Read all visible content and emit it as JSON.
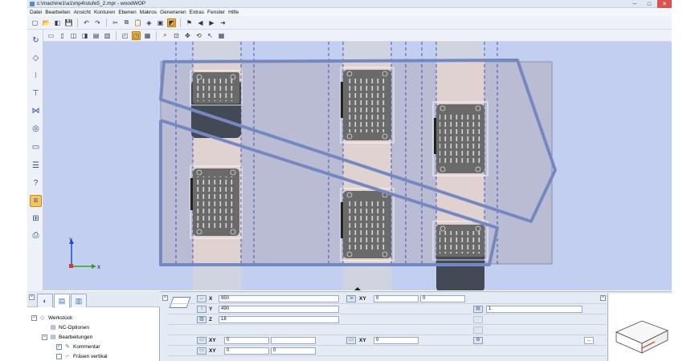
{
  "window": {
    "title": "c:\\machine1\\a1\\mp4\\stufe5_2.mpr - woodWOP",
    "controls": {
      "minimize": "─",
      "maximize": "□",
      "close": "✕"
    }
  },
  "menu": [
    "Datei",
    "Bearbeiten",
    "Ansicht",
    "Konturen",
    "Ebenen",
    "Makros",
    "Generieren",
    "Extras",
    "Fenster",
    "Hilfe"
  ],
  "toolbar1": {
    "icons": [
      "new-file-icon",
      "open-icon",
      "open-recent-icon",
      "save-icon",
      "undo-icon",
      "redo-icon",
      "cut-icon",
      "copy-icon",
      "paste-icon",
      "view-3d-icon",
      "view-top-icon",
      "view-iso-icon",
      "filter-icon",
      "back-icon",
      "play-icon",
      "forward-icon"
    ],
    "glyphs": [
      "▢",
      "📂",
      "◧",
      "💾",
      "↶",
      "↷",
      "✂",
      "⧉",
      "📋",
      "◈",
      "▣",
      "◩",
      "⚑",
      "◀",
      "▶",
      "➜"
    ]
  },
  "toolbar2": {
    "icons": [
      "view-front-icon",
      "view-back-icon",
      "view-left-icon",
      "view-right-icon",
      "view-top-icon",
      "view-bottom-icon",
      "wireframe-icon",
      "shaded-icon",
      "render-icon",
      "zoom-icon",
      "zoom-fit-icon",
      "pan-icon",
      "rotate-icon",
      "pointer-icon",
      "grid-icon"
    ],
    "glyphs": [
      "▭",
      "▯",
      "◫",
      "◨",
      "▤",
      "▥",
      "◰",
      "◳",
      "▦",
      "⌕",
      "⊡",
      "✥",
      "⟲",
      "↖",
      "▦"
    ]
  },
  "left_tools": {
    "items": [
      "contour-tool",
      "workpiece-tool",
      "drill-tool",
      "router-tool",
      "saw-tool",
      "circle-tool",
      "pocket-tool",
      "document-tool",
      "help-macro-tool",
      "component-tool",
      "group-tool",
      "print-tool"
    ],
    "glyphs": [
      "↻",
      "◇",
      "⁝",
      "⊤",
      "⋈",
      "◎",
      "▭",
      "☰",
      "?",
      "≡",
      "⊞",
      "⎙"
    ]
  },
  "viewport": {
    "axis": {
      "x": "X",
      "y": "Y"
    }
  },
  "tree": {
    "tabs": [
      "◐",
      "▤",
      "▥"
    ],
    "nodes": [
      {
        "label": "Werkstück",
        "expander": "−",
        "icon": "◇"
      },
      {
        "label": "NC-Optionen",
        "expander": "",
        "icon": "▤"
      },
      {
        "label": "Bearbeitungen",
        "expander": "−",
        "icon": "▤"
      },
      {
        "label": "Kommentar",
        "check": "✓",
        "icon": "✎"
      },
      {
        "label": "Fräsen vertikal",
        "check": "",
        "icon": "⌐"
      }
    ]
  },
  "properties": {
    "row1": {
      "label": "X",
      "value": "950",
      "xy_label": "XY",
      "xy_x": "0",
      "xy_y": "0"
    },
    "row2": {
      "label": "Y",
      "value": "490",
      "count_value": "1"
    },
    "row3": {
      "label": "Z",
      "value": "18"
    },
    "row5": {
      "xy1_label": "XY",
      "xy1_x": "0",
      "xy2_label": "XY",
      "xy2_x": "0",
      "more": "..."
    },
    "row6": {
      "xy_label": "XY",
      "xy_x": "0",
      "xy_y": "0"
    }
  }
}
